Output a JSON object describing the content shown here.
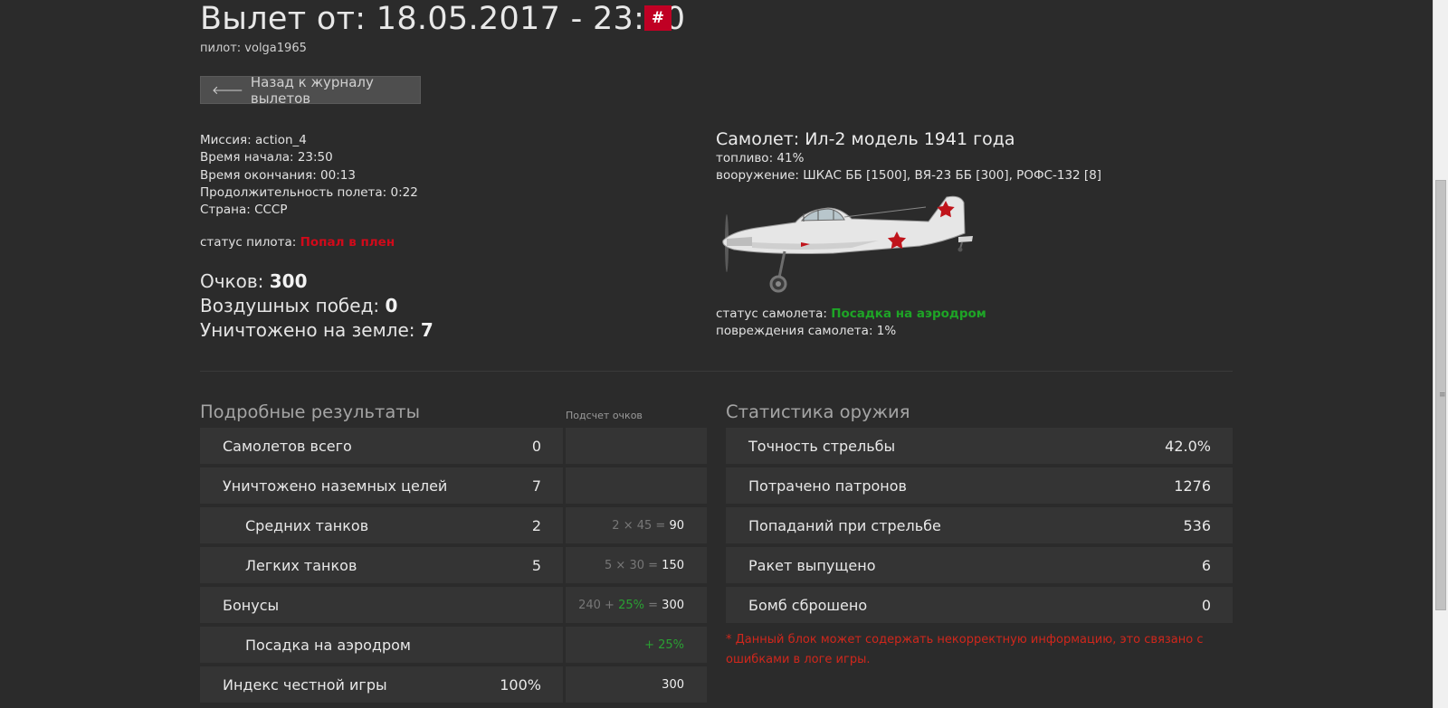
{
  "header": {
    "title": "Вылет от: 18.05.2017 - 23:50",
    "hash_label": "#",
    "pilot_line": "пилот: volga1965",
    "back_button": "Назад к журналу вылетов"
  },
  "mission_info": [
    "Миссия: action_4",
    "Время начала: 23:50",
    "Время окончания: 00:13",
    "Продолжительность полета: 0:22",
    "Страна: СССР"
  ],
  "pilot_status": {
    "label": "статус пилота:",
    "value": "Попал в плен",
    "value_color": "#d00a1a"
  },
  "scores": {
    "points_label": "Очков:",
    "points_value": "300",
    "air_label": "Воздушных побед:",
    "air_value": "0",
    "ground_label": "Уничтожено на земле:",
    "ground_value": "7"
  },
  "aircraft": {
    "title": "Самолет: Ил-2 модель 1941 года",
    "fuel": "топливо: 41%",
    "armament": "вооружение: ШКАС ББ [1500], ВЯ-23 ББ [300], РОФС-132 [8]",
    "status_label": "статус самолета:",
    "status_value": "Посадка на аэродром",
    "status_color": "#1ea526",
    "damage": "повреждения самолета: 1%"
  },
  "detailed": {
    "title": "Подробные результаты",
    "score_header": "Подсчет очков",
    "rows": [
      {
        "label": "Самолетов всего",
        "value": "0",
        "calc_prefix": "",
        "calc_pct": "",
        "calc_eq": "",
        "calc_result": ""
      },
      {
        "label": "Уничтожено наземных целей",
        "value": "7",
        "calc_prefix": "",
        "calc_pct": "",
        "calc_eq": "",
        "calc_result": ""
      },
      {
        "label": "Средних танков",
        "value": "2",
        "calc_prefix": "2 × 45",
        "calc_pct": "",
        "calc_eq": " = ",
        "calc_result": "90"
      },
      {
        "label": "Легких танков",
        "value": "5",
        "calc_prefix": "5 × 30",
        "calc_pct": "",
        "calc_eq": " = ",
        "calc_result": "150"
      },
      {
        "label": "Бонусы",
        "value": "",
        "calc_prefix": "240 + ",
        "calc_pct": "25%",
        "calc_eq": " = ",
        "calc_result": "300"
      },
      {
        "label": "Посадка на аэродром",
        "value": "",
        "calc_prefix": "",
        "calc_pct": "+ 25%",
        "calc_eq": "",
        "calc_result": ""
      },
      {
        "label": "Индекс честной игры",
        "value": "100%",
        "calc_prefix": "",
        "calc_pct": "",
        "calc_eq": "",
        "calc_result": "300"
      }
    ]
  },
  "weapons": {
    "title": "Статистика оружия",
    "rows": [
      {
        "label": "Точность стрельбы",
        "value": "42.0%"
      },
      {
        "label": "Потрачено патронов",
        "value": "1276"
      },
      {
        "label": "Попаданий при стрельбе",
        "value": "536"
      },
      {
        "label": "Ракет выпущено",
        "value": "6"
      },
      {
        "label": "Бомб сброшено",
        "value": "0"
      }
    ],
    "note": "* Данный блок может содержать некорректную информацию, это связано с ошибками в логе игры."
  }
}
